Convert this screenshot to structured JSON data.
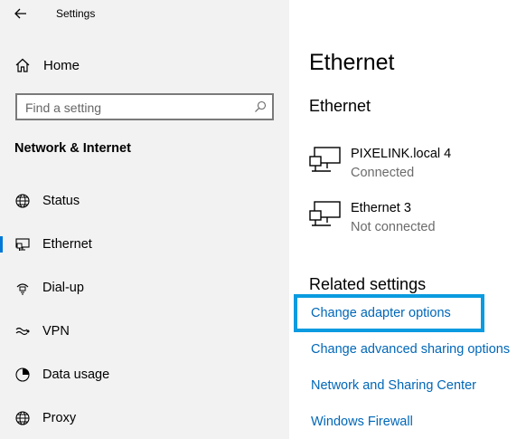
{
  "window": {
    "title": "Settings"
  },
  "sidebar": {
    "home_label": "Home",
    "search_placeholder": "Find a setting",
    "section_title": "Network & Internet",
    "items": [
      {
        "label": "Status",
        "icon": "globe-icon",
        "selected": false
      },
      {
        "label": "Ethernet",
        "icon": "ethernet-icon",
        "selected": true
      },
      {
        "label": "Dial-up",
        "icon": "dialup-icon",
        "selected": false
      },
      {
        "label": "VPN",
        "icon": "vpn-icon",
        "selected": false
      },
      {
        "label": "Data usage",
        "icon": "data-usage-icon",
        "selected": false
      },
      {
        "label": "Proxy",
        "icon": "globe-icon",
        "selected": false
      }
    ]
  },
  "main": {
    "page_title": "Ethernet",
    "section_title": "Ethernet",
    "networks": [
      {
        "name": "PIXELINK.local 4",
        "status": "Connected"
      },
      {
        "name": "Ethernet 3",
        "status": "Not connected"
      }
    ],
    "related_title": "Related settings",
    "links": [
      "Change adapter options",
      "Change advanced sharing options",
      "Network and Sharing Center",
      "Windows Firewall"
    ]
  },
  "colors": {
    "link": "#0067b8",
    "highlight_border": "#0a9be0",
    "selected_indicator": "#0078d7",
    "sidebar_bg": "#f2f2f2"
  }
}
